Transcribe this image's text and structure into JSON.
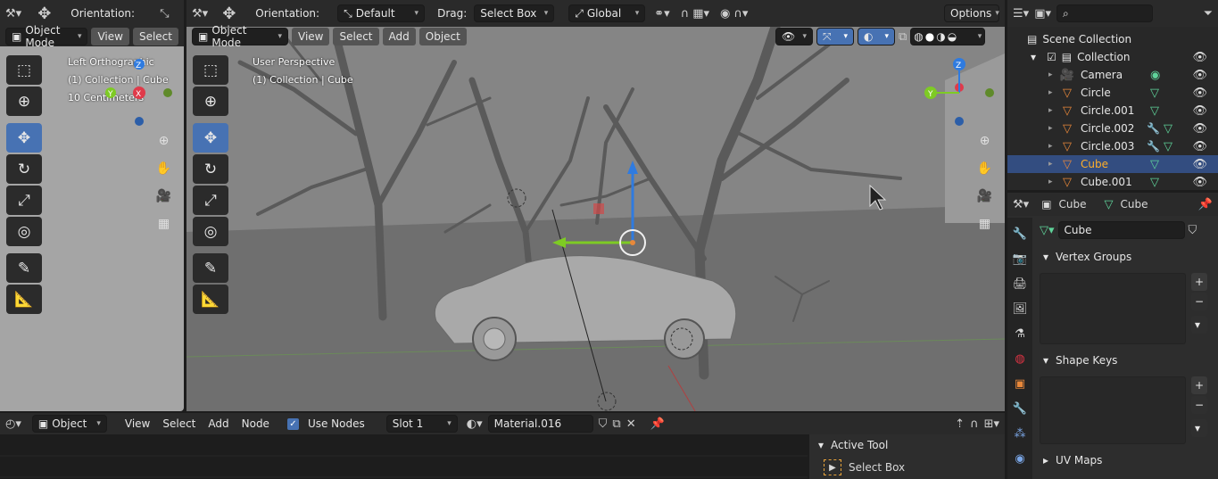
{
  "left_viewport": {
    "header": {
      "orientation_label": "Orientation:"
    },
    "mode": "Object Mode",
    "menu": [
      "View",
      "Select"
    ],
    "overlay": [
      "Left Orthographic",
      "(1) Collection | Cube",
      "10 Centimeters"
    ]
  },
  "main_viewport": {
    "header": {
      "orientation_label": "Orientation:",
      "orientation_value": "Default",
      "drag_label": "Drag:",
      "drag_value": "Select Box",
      "transform_value": "Global",
      "options_label": "Options"
    },
    "mode": "Object Mode",
    "menu": [
      "View",
      "Select",
      "Add",
      "Object"
    ],
    "overlay": [
      "User Perspective",
      "(1) Collection | Cube"
    ]
  },
  "gizmo": {
    "x": "X",
    "y": "Y",
    "z": "Z"
  },
  "outliner": {
    "root": "Scene Collection",
    "collection": "Collection",
    "items": [
      {
        "name": "Camera",
        "selected": false
      },
      {
        "name": "Circle",
        "selected": false
      },
      {
        "name": "Circle.001",
        "selected": false
      },
      {
        "name": "Circle.002",
        "selected": false
      },
      {
        "name": "Circle.003",
        "selected": false
      },
      {
        "name": "Cube",
        "selected": true
      },
      {
        "name": "Cube.001",
        "selected": false
      }
    ]
  },
  "properties": {
    "breadcrumb_object": "Cube",
    "breadcrumb_data": "Cube",
    "mesh_name": "Cube",
    "sections": [
      "Vertex Groups",
      "Shape Keys",
      "UV Maps"
    ]
  },
  "node_editor": {
    "type": "Object",
    "menu": [
      "View",
      "Select",
      "Add",
      "Node"
    ],
    "use_nodes_label": "Use Nodes",
    "slot": "Slot 1",
    "material": "Material.016"
  },
  "active_tool_panel": {
    "title": "Active Tool",
    "tool": "Select Box"
  },
  "colors": {
    "accent": "#4772b3",
    "selection": "#334d80",
    "viewport_bg": "#7a7a7a"
  }
}
